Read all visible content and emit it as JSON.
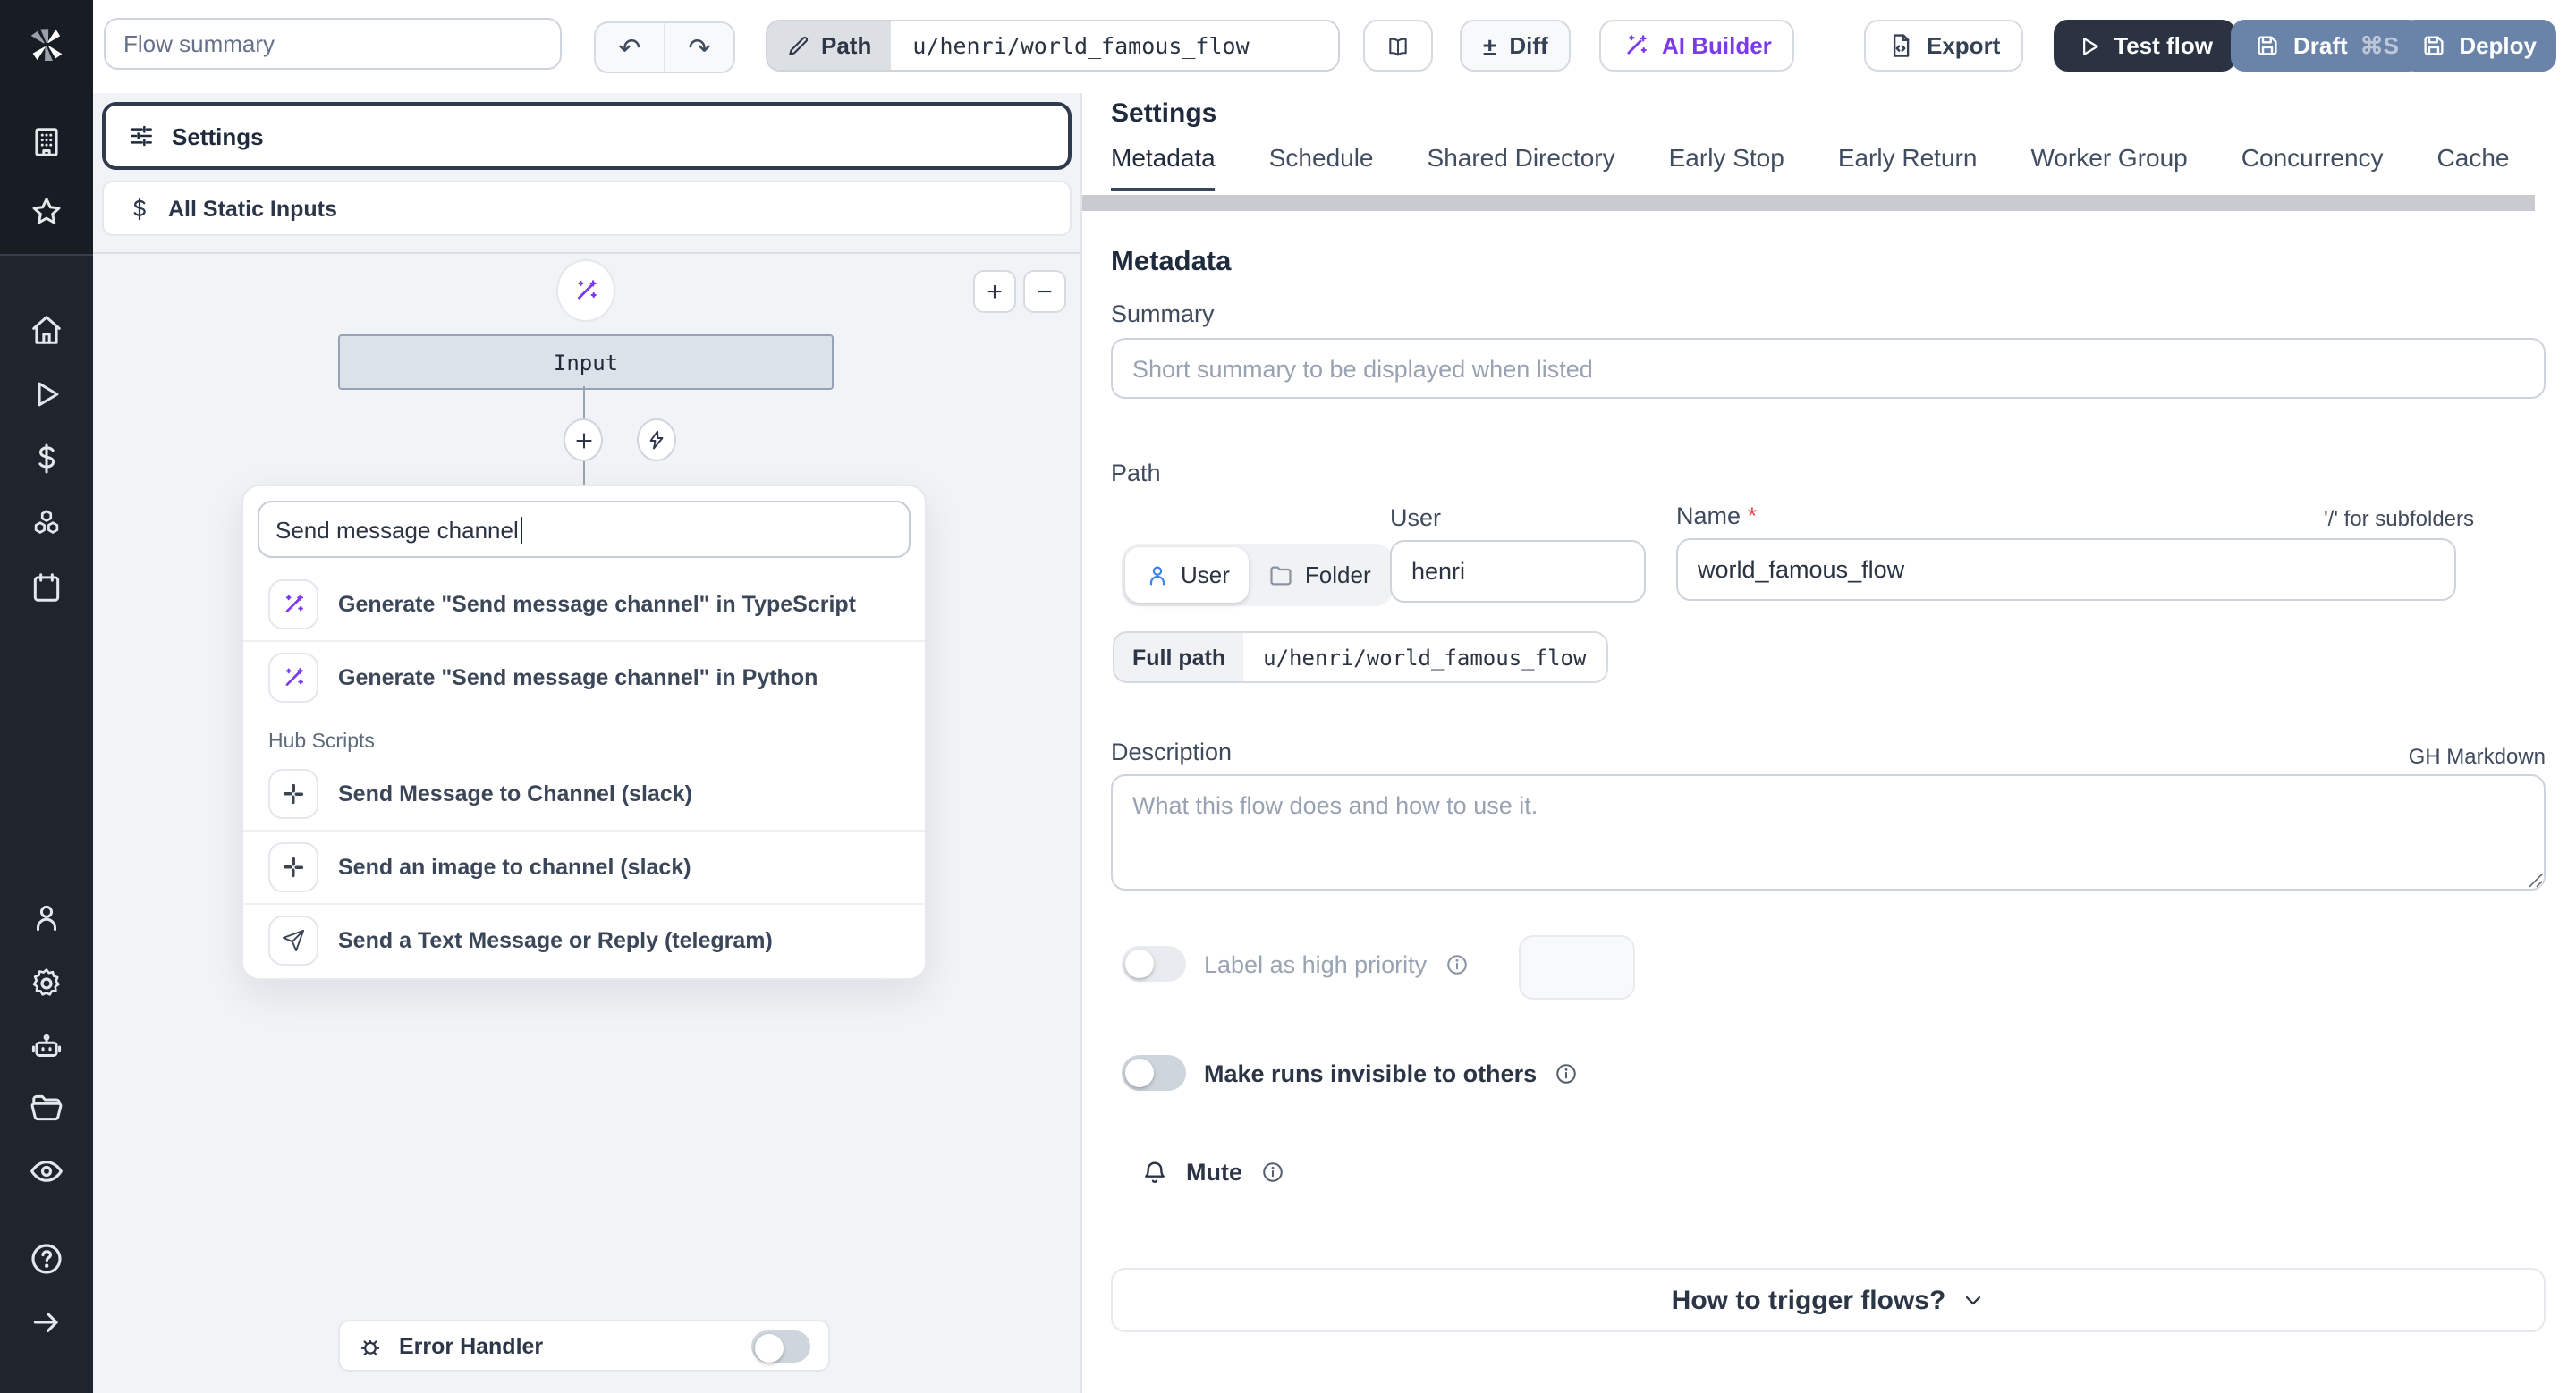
{
  "topbar": {
    "flow_summary_placeholder": "Flow summary",
    "undo_glyph": "↶",
    "redo_glyph": "↷",
    "path_label": "Path",
    "path_value": "u/henri/world_famous_flow",
    "diff_label": "Diff",
    "diff_glyph": "±",
    "ai_builder_label": "AI Builder",
    "export_label": "Export",
    "test_flow_label": "Test flow",
    "draft_label": "Draft",
    "draft_shortcut": "⌘S",
    "deploy_label": "Deploy"
  },
  "flow_editor": {
    "settings_card_label": "Settings",
    "static_inputs_label": "All Static Inputs",
    "zoom_in_label": "+",
    "zoom_out_label": "−",
    "input_node_label": "Input",
    "search_value": "Send message channel",
    "results": {
      "generate": [
        {
          "label": "Generate \"Send message channel\" in TypeScript"
        },
        {
          "label": "Generate \"Send message channel\" in Python"
        }
      ],
      "section_label": "Hub Scripts",
      "hub": [
        {
          "label": "Send Message to Channel (slack)",
          "icon": "slack-icon"
        },
        {
          "label": "Send an image to channel (slack)",
          "icon": "slack-icon"
        },
        {
          "label": "Send a Text Message or Reply (telegram)",
          "icon": "telegram-send-icon"
        }
      ]
    },
    "error_handler_label": "Error Handler"
  },
  "settings_panel": {
    "title": "Settings",
    "active_tab": "Metadata",
    "tabs": [
      "Metadata",
      "Schedule",
      "Shared Directory",
      "Early Stop",
      "Early Return",
      "Worker Group",
      "Concurrency",
      "Cache"
    ],
    "metadata": {
      "heading": "Metadata",
      "summary_label": "Summary",
      "summary_placeholder": "Short summary to be displayed when listed",
      "path_label": "Path",
      "owner_kind_user": "User",
      "owner_kind_folder": "Folder",
      "user_label": "User",
      "user_value": "henri",
      "name_label": "Name",
      "name_required_mark": "*",
      "name_value": "world_famous_flow",
      "subfolder_hint": "'/' for subfolders",
      "full_path_label": "Full path",
      "full_path_value": "u/henri/world_famous_flow",
      "description_label": "Description",
      "markdown_hint": "GH Markdown",
      "description_placeholder": "What this flow does and how to use it.",
      "high_priority_label": "Label as high priority",
      "invisible_runs_label": "Make runs invisible to others",
      "mute_label": "Mute",
      "trigger_button_label": "How to trigger flows?"
    }
  },
  "icons": {
    "sidebar": [
      "windmill-logo",
      "workspace-icon",
      "favorites-star-icon",
      "home-icon",
      "runs-play-icon",
      "variables-dollar-icon",
      "resources-boxes-icon",
      "schedules-calendar-icon",
      "user-icon",
      "settings-gear-icon",
      "workers-robot-icon",
      "folders-icon",
      "audit-eye-icon",
      "help-icon",
      "expand-arrow-icon"
    ],
    "topbar": [
      "pencil-icon",
      "book-icon",
      "diff-icon",
      "magic-wand-icon",
      "export-file-icon",
      "play-icon",
      "save-icon"
    ],
    "editor": [
      "sliders-icon",
      "dollar-icon",
      "magic-wand-icon",
      "add-step-icon",
      "trigger-bolt-icon",
      "slack-icon",
      "telegram-send-icon",
      "bug-icon"
    ],
    "settings": [
      "user-icon",
      "folder-icon",
      "info-icon",
      "bell-icon",
      "chevron-down-icon"
    ]
  },
  "colors": {
    "accent_purple": "#7c3aed",
    "test_flow_button": "#2b3342",
    "draft_deploy_button": "#6a83a9",
    "sidebar_bg": "#20242d",
    "selected_card_border": "#2f3a4c",
    "node_bg": "#dbe2ea",
    "panel_bg": "#f1f3f6",
    "required_red": "#e5484d",
    "user_icon_blue": "#3b82f6"
  }
}
